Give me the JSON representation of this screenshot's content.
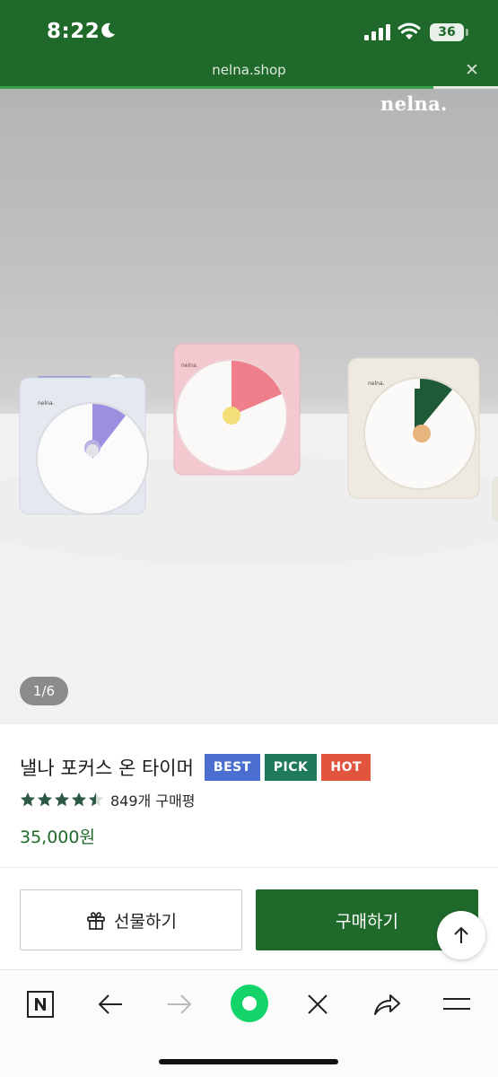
{
  "status_bar": {
    "time": "8:22",
    "battery": "36"
  },
  "browser": {
    "url": "nelna.shop",
    "load_progress": 0.87
  },
  "hero": {
    "brand_watermark": "nelna.",
    "pager": "1/6",
    "product_image": "three-pastel-focus-timers-on-white-table"
  },
  "product": {
    "title": "낼나 포커스 온 타이머",
    "badges": [
      {
        "label": "BEST",
        "color": "#4a6fd0"
      },
      {
        "label": "PICK",
        "color": "#1f7a5c"
      },
      {
        "label": "HOT",
        "color": "#e1553f"
      }
    ],
    "rating": 4.5,
    "review_text": "849개 구매평",
    "price": "35,000원"
  },
  "actions": {
    "gift_label": "선물하기",
    "buy_label": "구매하기"
  },
  "toolbar_icons": [
    "naver-n-icon",
    "back-arrow-icon",
    "forward-arrow-icon",
    "green-dot-icon",
    "close-icon",
    "share-icon",
    "menu-icon"
  ],
  "colors": {
    "brand_green": "#1f6a2b",
    "accent_light_green": "#37a349"
  }
}
